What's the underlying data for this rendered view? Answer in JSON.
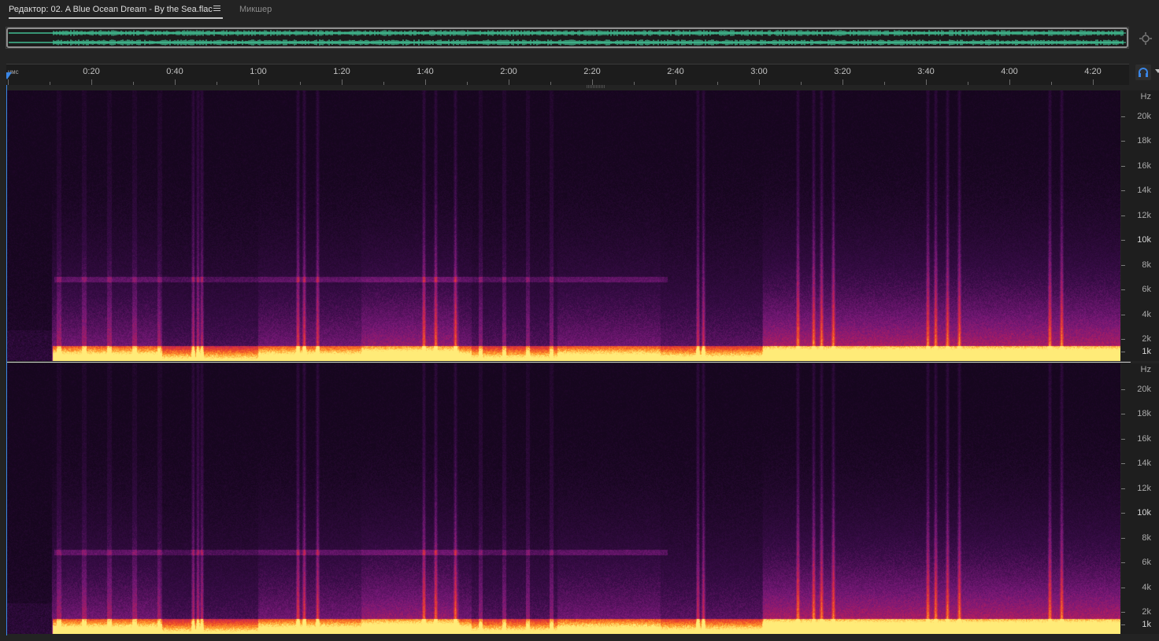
{
  "tabs": {
    "editor_label": "Редактор: 02. A Blue Ocean Dream - By the Sea.flac",
    "mixer_label": "Микшер"
  },
  "ruler": {
    "unit": "чмс",
    "labels": [
      "0:20",
      "0:40",
      "1:00",
      "1:20",
      "1:40",
      "2:00",
      "2:20",
      "2:40",
      "3:00",
      "3:20",
      "3:40",
      "4:00",
      "4:20"
    ]
  },
  "frequency_axis": {
    "unit": "Hz",
    "labels": [
      "20k",
      "18k",
      "16k",
      "14k",
      "12k",
      "10k",
      "8k",
      "6k",
      "4k",
      "2k",
      "1k"
    ]
  },
  "colors": {
    "waveform": "#48d6a4",
    "playhead": "#3a86e6",
    "spectrogram_low": "#18081f",
    "spectrogram_mid": "#8a1a8a",
    "spectrogram_high": "#ffe060"
  },
  "icons": {
    "zoom_navigator": "zoom-navigator-icon",
    "loop_playback": "headphones-loop-icon",
    "tab_menu": "hamburger-menu-icon"
  }
}
